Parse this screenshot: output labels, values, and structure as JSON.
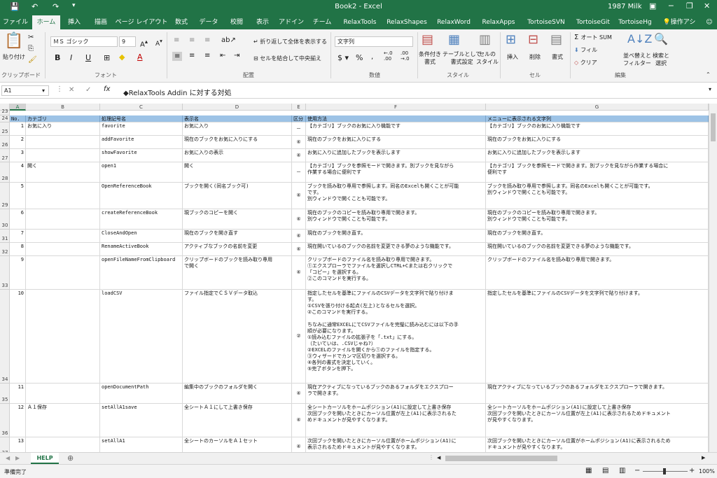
{
  "titlebar": {
    "title": "Book2  -  Excel",
    "user": "1987 Milk",
    "save_icon": "save-icon",
    "bg": "#217346"
  },
  "tabs": [
    "ファイル",
    "ホーム",
    "挿入",
    "描画",
    "ページ レイアウト",
    "数式",
    "データ",
    "校閲",
    "表示",
    "アドイン",
    "チーム",
    "RelaxTools",
    "RelaxShapes",
    "RelaxWord",
    "RelaxApps",
    "TortoiseSVN",
    "TortoiseGit",
    "TortoiseHg"
  ],
  "tell_me": "操作アシ",
  "ribbon": {
    "clipboard": {
      "paste": "貼り付け",
      "label": "クリップボード"
    },
    "font": {
      "name": "ＭＳ ゴシック",
      "size": "9",
      "label": "フォント",
      "bold": "B",
      "italic": "I",
      "underline": "U"
    },
    "alignment": {
      "wrap": "折り返して全体を表示する",
      "merge": "セルを結合して中央揃え",
      "label": "配置"
    },
    "number": {
      "format": "文字列",
      "label": "数値"
    },
    "styles": {
      "conditional": "条件付き\n書式",
      "table": "テーブルとして\n書式設定",
      "cell": "セルの\nスタイル",
      "label": "スタイル"
    },
    "cells": {
      "insert": "挿入",
      "delete": "削除",
      "format": "書式",
      "label": "セル"
    },
    "editing": {
      "autosum": "オート SUM",
      "fill": "フィル",
      "clear": "クリア",
      "sort": "並べ替えと\nフィルター",
      "find": "検索と\n選択",
      "label": "編集"
    }
  },
  "formula": {
    "namebox": "A1",
    "content": "◆RelaxTools Addin に対する対処"
  },
  "columns": [
    "A",
    "B",
    "C",
    "D",
    "E",
    "F",
    "G"
  ],
  "header_row": {
    "no": "No.",
    "category": "カテゴリ",
    "func": "処理記号名",
    "display": "表示名",
    "kubun": "区分",
    "usage": "使用方法",
    "menu": "メニューに表示される文字列"
  },
  "rows": [
    {
      "rn": "25",
      "no": "1",
      "cat": "お気に入り",
      "func": "favorite",
      "disp": "お気に入り",
      "kubun": "－",
      "usage": "【カテゴリ】ブックのお気に入り機能です",
      "menu": "【カテゴリ】ブックのお気に入り機能です"
    },
    {
      "rn": "26",
      "no": "2",
      "cat": "",
      "func": "addFavorite",
      "disp": "現在のブックをお気に入りにする",
      "kubun": "④",
      "usage": "現在のブックをお気に入りにする",
      "menu": "現在のブックをお気に入りにする"
    },
    {
      "rn": "27",
      "no": "3",
      "cat": "",
      "func": "showFavorite",
      "disp": "お気に入りの表示",
      "kubun": "④",
      "usage": "お気に入りに追加したブックを表示します",
      "menu": "お気に入りに追加したブックを表示します"
    },
    {
      "rn": "28",
      "no": "4",
      "cat": "開く",
      "func": "open1",
      "disp": "開く",
      "kubun": "－",
      "usage": "【カテゴリ】ブックを参照モードで開きます。別ブックを見ながら\n作業する場合に便利です",
      "menu": "【カテゴリ】ブックを参照モードで開きます。別ブックを見ながら作業する場合に\n便利です"
    },
    {
      "rn": "29",
      "no": "5",
      "cat": "",
      "func": "OpenReferenceBook",
      "disp": "ブックを開く(同名ブック可)",
      "kubun": "④",
      "usage": "ブックを読み取り専用で参照します。同名のExcelも開くことが可能\nです。\n別ウィンドウで開くことも可能です。",
      "menu": "ブックを読み取り専用で参照します。同名のExcelも開くことが可能です。\n別ウィンドウで開くことも可能です。"
    },
    {
      "rn": "30",
      "no": "6",
      "cat": "",
      "func": "createReferenceBook",
      "disp": "現ブックのコピーを開く",
      "kubun": "④",
      "usage": "現在のブックのコピーを読み取り専用で開きます。\n別ウィンドウで開くことも可能です。",
      "menu": "現在のブックのコピーを読み取り専用で開きます。\n別ウィンドウで開くことも可能です。"
    },
    {
      "rn": "31",
      "no": "7",
      "cat": "",
      "func": "CloseAndOpen",
      "disp": "現在のブックを開き直す",
      "kubun": "④",
      "usage": "現在のブックを開き直す。",
      "menu": "現在のブックを開き直す。"
    },
    {
      "rn": "32",
      "no": "8",
      "cat": "",
      "func": "RenameActiveBook",
      "disp": "アクティブなブックの名前を変更",
      "kubun": "④",
      "usage": "現在開いているのブックの名前を変更できる夢のような機能です。",
      "menu": "現在開いているのブックの名前を変更できる夢のような機能です。"
    },
    {
      "rn": "33",
      "no": "9",
      "cat": "",
      "func": "openFileNameFromClipboard",
      "disp": "クリップボードのブックを読み取り専用\nで開く",
      "kubun": "④",
      "usage": "クリップボードのファイル名を読み取り専用で開きます。\n①エクスプローラでファイルを選択しCTRL+Cまたは右クリックで\n「コピー」を選択する。\n②このコマンドを実行する。",
      "menu": "クリップボードのファイル名を読み取り専用で開きます。"
    },
    {
      "rn": "34",
      "no": "10",
      "cat": "",
      "func": "loadCSV",
      "disp": "ファイル指定でＣＳＶデータ取込",
      "kubun": "②",
      "usage": "指定したセルを基準にファイルのCSVデータを文字列で貼り付けま\nす。\n①CSVを張り付ける起点(左上)となるセルを選択。\n②このコマンドを実行する。\n\nちなみに通常EXCELにてCSVファイルを完璧に読み込むには以下の手\n順が必要になります。\n①読み込むファイルの拡張子を「.txt」にする。\n（たいていは、.CSVじゃね?）\n②EXCELのファイルを開くから①のファイルを指定する。\n③ウィザードでカンマ区切りを選択する。\n④各列の書式を決定していく。\n⑤完了ボタンを押下。",
      "menu": "指定したセルを基準にファイルのCSVデータを文字列で貼り付けます。"
    },
    {
      "rn": "35",
      "no": "11",
      "cat": "",
      "func": "openDocumentPath",
      "disp": "編集中のブックのフォルダを開く",
      "kubun": "④",
      "usage": "現在アクティブになっているブックのあるフォルダをエクスプロー\nラで開きます。",
      "menu": "現在アクティブになっているブックのあるフォルダをエクスプローラで開きます。"
    },
    {
      "rn": "36",
      "no": "12",
      "cat": "Ａ１保存",
      "func": "setAllA1save",
      "disp": "全シートＡ１にして上書き保存",
      "kubun": "④",
      "usage": "全シートカーソルをホームポジション(A1)に設定して上書き保存\n次回ブックを開いたときにカーソル位置が左上(A1)に表示されるた\nめドキュメントが見やすくなります。",
      "menu": "全シートカーソルをホームポジション(A1)に設定して上書き保存\n次回ブックを開いたときにカーソル位置が左上(A1)に表示されるためドキュメント\nが見やすくなります。"
    },
    {
      "rn": "37",
      "no": "13",
      "cat": "",
      "func": "setAllA1",
      "disp": "全シートのカーソルをＡ１セット",
      "kubun": "④",
      "usage": "次回ブックを開いたときにカーソル位置がホームポジション(A1)に\n表示されるためドキュメントが見やすくなります。",
      "menu": "次回ブックを開いたときにカーソル位置がホームポジション(A1)に表示されるため\nドキュメントが見やすくなります。"
    }
  ],
  "row23": "23",
  "row24": "24",
  "sheet_tab": "HELP",
  "status": {
    "ready": "準備完了",
    "zoom": "100%"
  },
  "accent": "#217346",
  "header_fill": "#9dc3e6"
}
